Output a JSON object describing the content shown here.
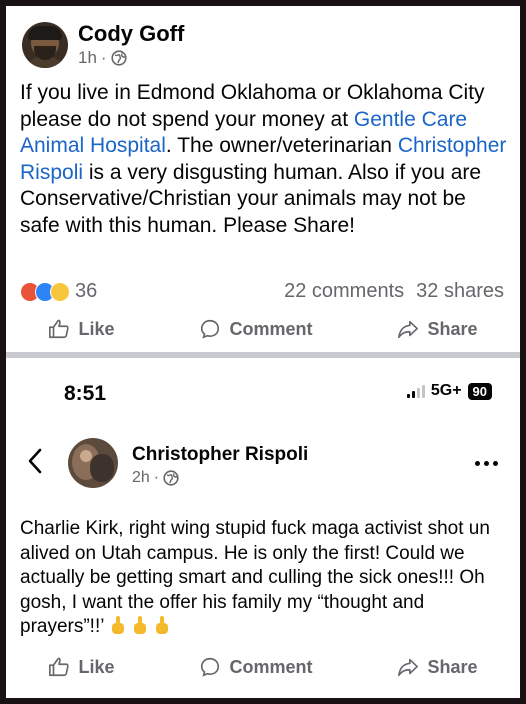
{
  "post1": {
    "author": "Cody Goff",
    "time": "1h",
    "separator": "·",
    "body_part1": "If you live in Edmond Oklahoma or Oklahoma City please do not spend your money at ",
    "link1": "Gentle Care Animal Hospital",
    "body_part2": ". The owner/veterinarian ",
    "link2": "Christopher Rispoli",
    "body_part3": " is a very disgusting human. Also if you are Conservative/Christian your animals may not be safe with this human. Please Share!",
    "reaction_count": "36",
    "comments": "22 comments",
    "shares": "32 shares",
    "actions": {
      "like": "Like",
      "comment": "Comment",
      "share": "Share"
    }
  },
  "status_bar": {
    "time": "8:51",
    "network": "5G+",
    "battery": "90"
  },
  "post2": {
    "author": "Christopher Rispoli",
    "time": "2h",
    "separator": "·",
    "body": "Charlie Kirk, right wing stupid fuck maga activist shot un alived on Utah campus. He is only the first! Could we actually be getting smart and culling the sick ones!!!  Oh gosh, I want the offer his family my “thought and prayers”!!’",
    "actions": {
      "like": "Like",
      "comment": "Comment",
      "share": "Share"
    }
  },
  "colors": {
    "link": "#1b64c8",
    "secondary_text": "#65676b",
    "divider": "#c9cacf"
  }
}
